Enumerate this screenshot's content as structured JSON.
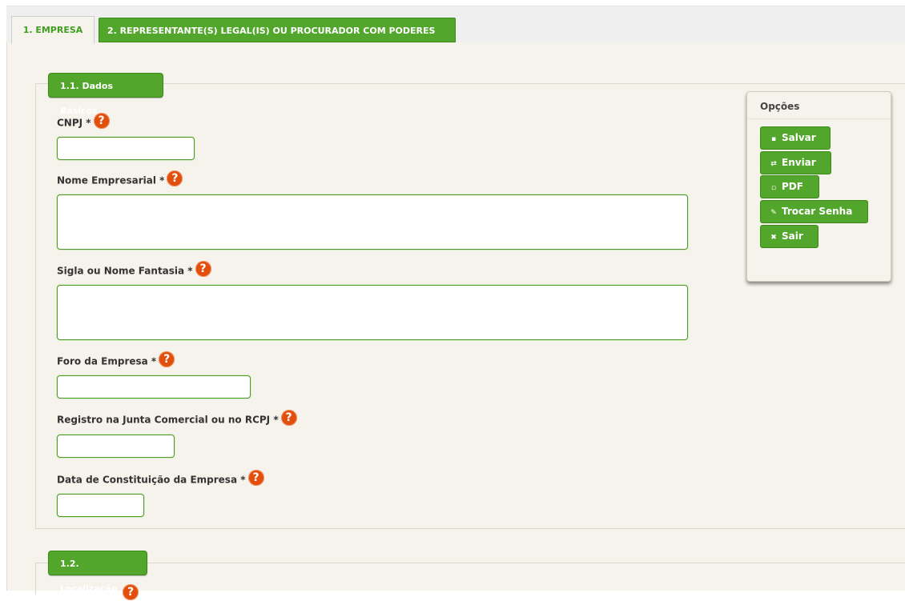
{
  "tabs": [
    {
      "label": "1. EMPRESA"
    },
    {
      "label": "2. REPRESENTANTE(S) LEGAL(IS) OU PROCURADOR COM PODERES"
    }
  ],
  "sections": {
    "dados_basicos": {
      "title": "1.1. Dados Básicos"
    },
    "localizacao": {
      "title": "1.2. Localização"
    }
  },
  "form": {
    "cnpj": {
      "label": "CNPJ *",
      "value": ""
    },
    "nome_empresarial": {
      "label": "Nome Empresarial *",
      "value": ""
    },
    "sigla": {
      "label": "Sigla ou Nome Fantasia *",
      "value": ""
    },
    "foro": {
      "label": "Foro da Empresa *",
      "value": ""
    },
    "registro": {
      "label": "Registro na Junta Comercial ou no RCPJ *",
      "value": ""
    },
    "data_constituicao": {
      "label": "Data de Constituição da Empresa *",
      "value": ""
    }
  },
  "help_icon": "question-mark-icon",
  "help_glyph": "?",
  "options": {
    "title": "Opções",
    "buttons": [
      {
        "label": "Salvar",
        "icon": "save-icon",
        "glyph": "▪"
      },
      {
        "label": "Enviar",
        "icon": "send-icon",
        "glyph": "⇄"
      },
      {
        "label": "PDF",
        "icon": "document-icon",
        "glyph": "▫"
      },
      {
        "label": "Trocar Senha",
        "icon": "key-icon",
        "glyph": "✎"
      },
      {
        "label": "Sair",
        "icon": "close-icon",
        "glyph": "✖"
      }
    ]
  },
  "colors": {
    "accent_green": "#52a62b",
    "help_orange": "#e24e0c",
    "background": "#f5f3ec"
  }
}
